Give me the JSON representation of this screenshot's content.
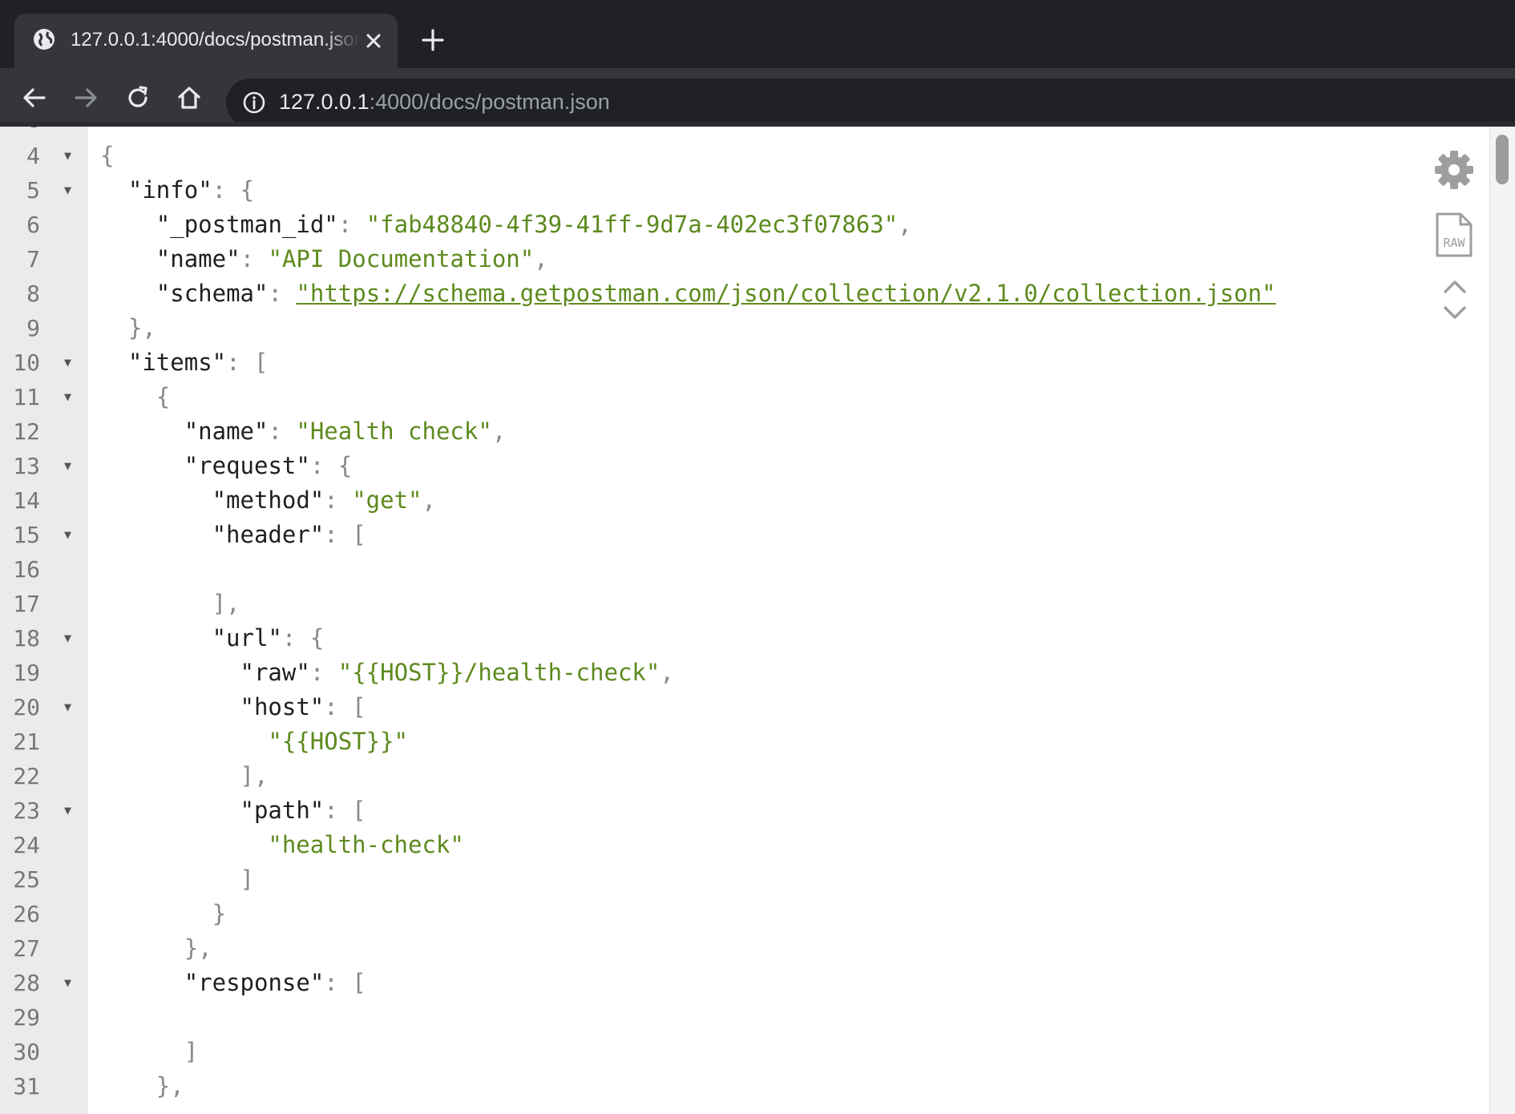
{
  "tab": {
    "title": "127.0.0.1:4000/docs/postman.json",
    "favicon": "globe-icon",
    "close_icon": "close-icon"
  },
  "toolbar": {
    "back_icon": "back-arrow-icon",
    "forward_icon": "forward-arrow-icon",
    "reload_icon": "reload-icon",
    "home_icon": "home-icon",
    "info_icon": "info-icon",
    "url_host": "127.0.0.1",
    "url_rest": ":4000/docs/postman.json"
  },
  "viewer": {
    "tools": [
      "settings-gear-icon",
      "raw-file-icon",
      "collapse-chevron-icon",
      "expand-chevron-icon"
    ],
    "raw_label": "RAW",
    "lines": [
      {
        "n": "4",
        "fold": "▼",
        "indent": 0,
        "tokens": [
          [
            "p",
            "{"
          ]
        ]
      },
      {
        "n": "5",
        "fold": "▼",
        "indent": 2,
        "tokens": [
          [
            "k",
            "\"info\""
          ],
          [
            "p",
            ": {"
          ]
        ]
      },
      {
        "n": "6",
        "fold": "",
        "indent": 4,
        "tokens": [
          [
            "k",
            "\"_postman_id\""
          ],
          [
            "p",
            ": "
          ],
          [
            "s",
            "\"fab48840-4f39-41ff-9d7a-402ec3f07863\""
          ],
          [
            "p",
            ","
          ]
        ]
      },
      {
        "n": "7",
        "fold": "",
        "indent": 4,
        "tokens": [
          [
            "k",
            "\"name\""
          ],
          [
            "p",
            ": "
          ],
          [
            "s",
            "\"API Documentation\""
          ],
          [
            "p",
            ","
          ]
        ]
      },
      {
        "n": "8",
        "fold": "",
        "indent": 4,
        "tokens": [
          [
            "k",
            "\"schema\""
          ],
          [
            "p",
            ": "
          ],
          [
            "l",
            "\"https://schema.getpostman.com/json/collection/v2.1.0/collection.json\""
          ]
        ]
      },
      {
        "n": "9",
        "fold": "",
        "indent": 2,
        "tokens": [
          [
            "p",
            "},"
          ]
        ]
      },
      {
        "n": "10",
        "fold": "▼",
        "indent": 2,
        "tokens": [
          [
            "k",
            "\"items\""
          ],
          [
            "p",
            ": ["
          ]
        ]
      },
      {
        "n": "11",
        "fold": "▼",
        "indent": 4,
        "tokens": [
          [
            "p",
            "{"
          ]
        ]
      },
      {
        "n": "12",
        "fold": "",
        "indent": 6,
        "tokens": [
          [
            "k",
            "\"name\""
          ],
          [
            "p",
            ": "
          ],
          [
            "s",
            "\"Health check\""
          ],
          [
            "p",
            ","
          ]
        ]
      },
      {
        "n": "13",
        "fold": "▼",
        "indent": 6,
        "tokens": [
          [
            "k",
            "\"request\""
          ],
          [
            "p",
            ": {"
          ]
        ]
      },
      {
        "n": "14",
        "fold": "",
        "indent": 8,
        "tokens": [
          [
            "k",
            "\"method\""
          ],
          [
            "p",
            ": "
          ],
          [
            "s",
            "\"get\""
          ],
          [
            "p",
            ","
          ]
        ]
      },
      {
        "n": "15",
        "fold": "▼",
        "indent": 8,
        "tokens": [
          [
            "k",
            "\"header\""
          ],
          [
            "p",
            ": ["
          ]
        ]
      },
      {
        "n": "16",
        "fold": "",
        "indent": 0,
        "tokens": []
      },
      {
        "n": "17",
        "fold": "",
        "indent": 8,
        "tokens": [
          [
            "p",
            "],"
          ]
        ]
      },
      {
        "n": "18",
        "fold": "▼",
        "indent": 8,
        "tokens": [
          [
            "k",
            "\"url\""
          ],
          [
            "p",
            ": {"
          ]
        ]
      },
      {
        "n": "19",
        "fold": "",
        "indent": 10,
        "tokens": [
          [
            "k",
            "\"raw\""
          ],
          [
            "p",
            ": "
          ],
          [
            "s",
            "\"{{HOST}}/health-check\""
          ],
          [
            "p",
            ","
          ]
        ]
      },
      {
        "n": "20",
        "fold": "▼",
        "indent": 10,
        "tokens": [
          [
            "k",
            "\"host\""
          ],
          [
            "p",
            ": ["
          ]
        ]
      },
      {
        "n": "21",
        "fold": "",
        "indent": 12,
        "tokens": [
          [
            "s",
            "\"{{HOST}}\""
          ]
        ]
      },
      {
        "n": "22",
        "fold": "",
        "indent": 10,
        "tokens": [
          [
            "p",
            "],"
          ]
        ]
      },
      {
        "n": "23",
        "fold": "▼",
        "indent": 10,
        "tokens": [
          [
            "k",
            "\"path\""
          ],
          [
            "p",
            ": ["
          ]
        ]
      },
      {
        "n": "24",
        "fold": "",
        "indent": 12,
        "tokens": [
          [
            "s",
            "\"health-check\""
          ]
        ]
      },
      {
        "n": "25",
        "fold": "",
        "indent": 10,
        "tokens": [
          [
            "p",
            "]"
          ]
        ]
      },
      {
        "n": "26",
        "fold": "",
        "indent": 8,
        "tokens": [
          [
            "p",
            "}"
          ]
        ]
      },
      {
        "n": "27",
        "fold": "",
        "indent": 6,
        "tokens": [
          [
            "p",
            "},"
          ]
        ]
      },
      {
        "n": "28",
        "fold": "▼",
        "indent": 6,
        "tokens": [
          [
            "k",
            "\"response\""
          ],
          [
            "p",
            ": ["
          ]
        ]
      },
      {
        "n": "29",
        "fold": "",
        "indent": 0,
        "tokens": []
      },
      {
        "n": "30",
        "fold": "",
        "indent": 6,
        "tokens": [
          [
            "p",
            "]"
          ]
        ]
      },
      {
        "n": "31",
        "fold": "",
        "indent": 4,
        "tokens": [
          [
            "p",
            "},"
          ]
        ]
      }
    ]
  }
}
